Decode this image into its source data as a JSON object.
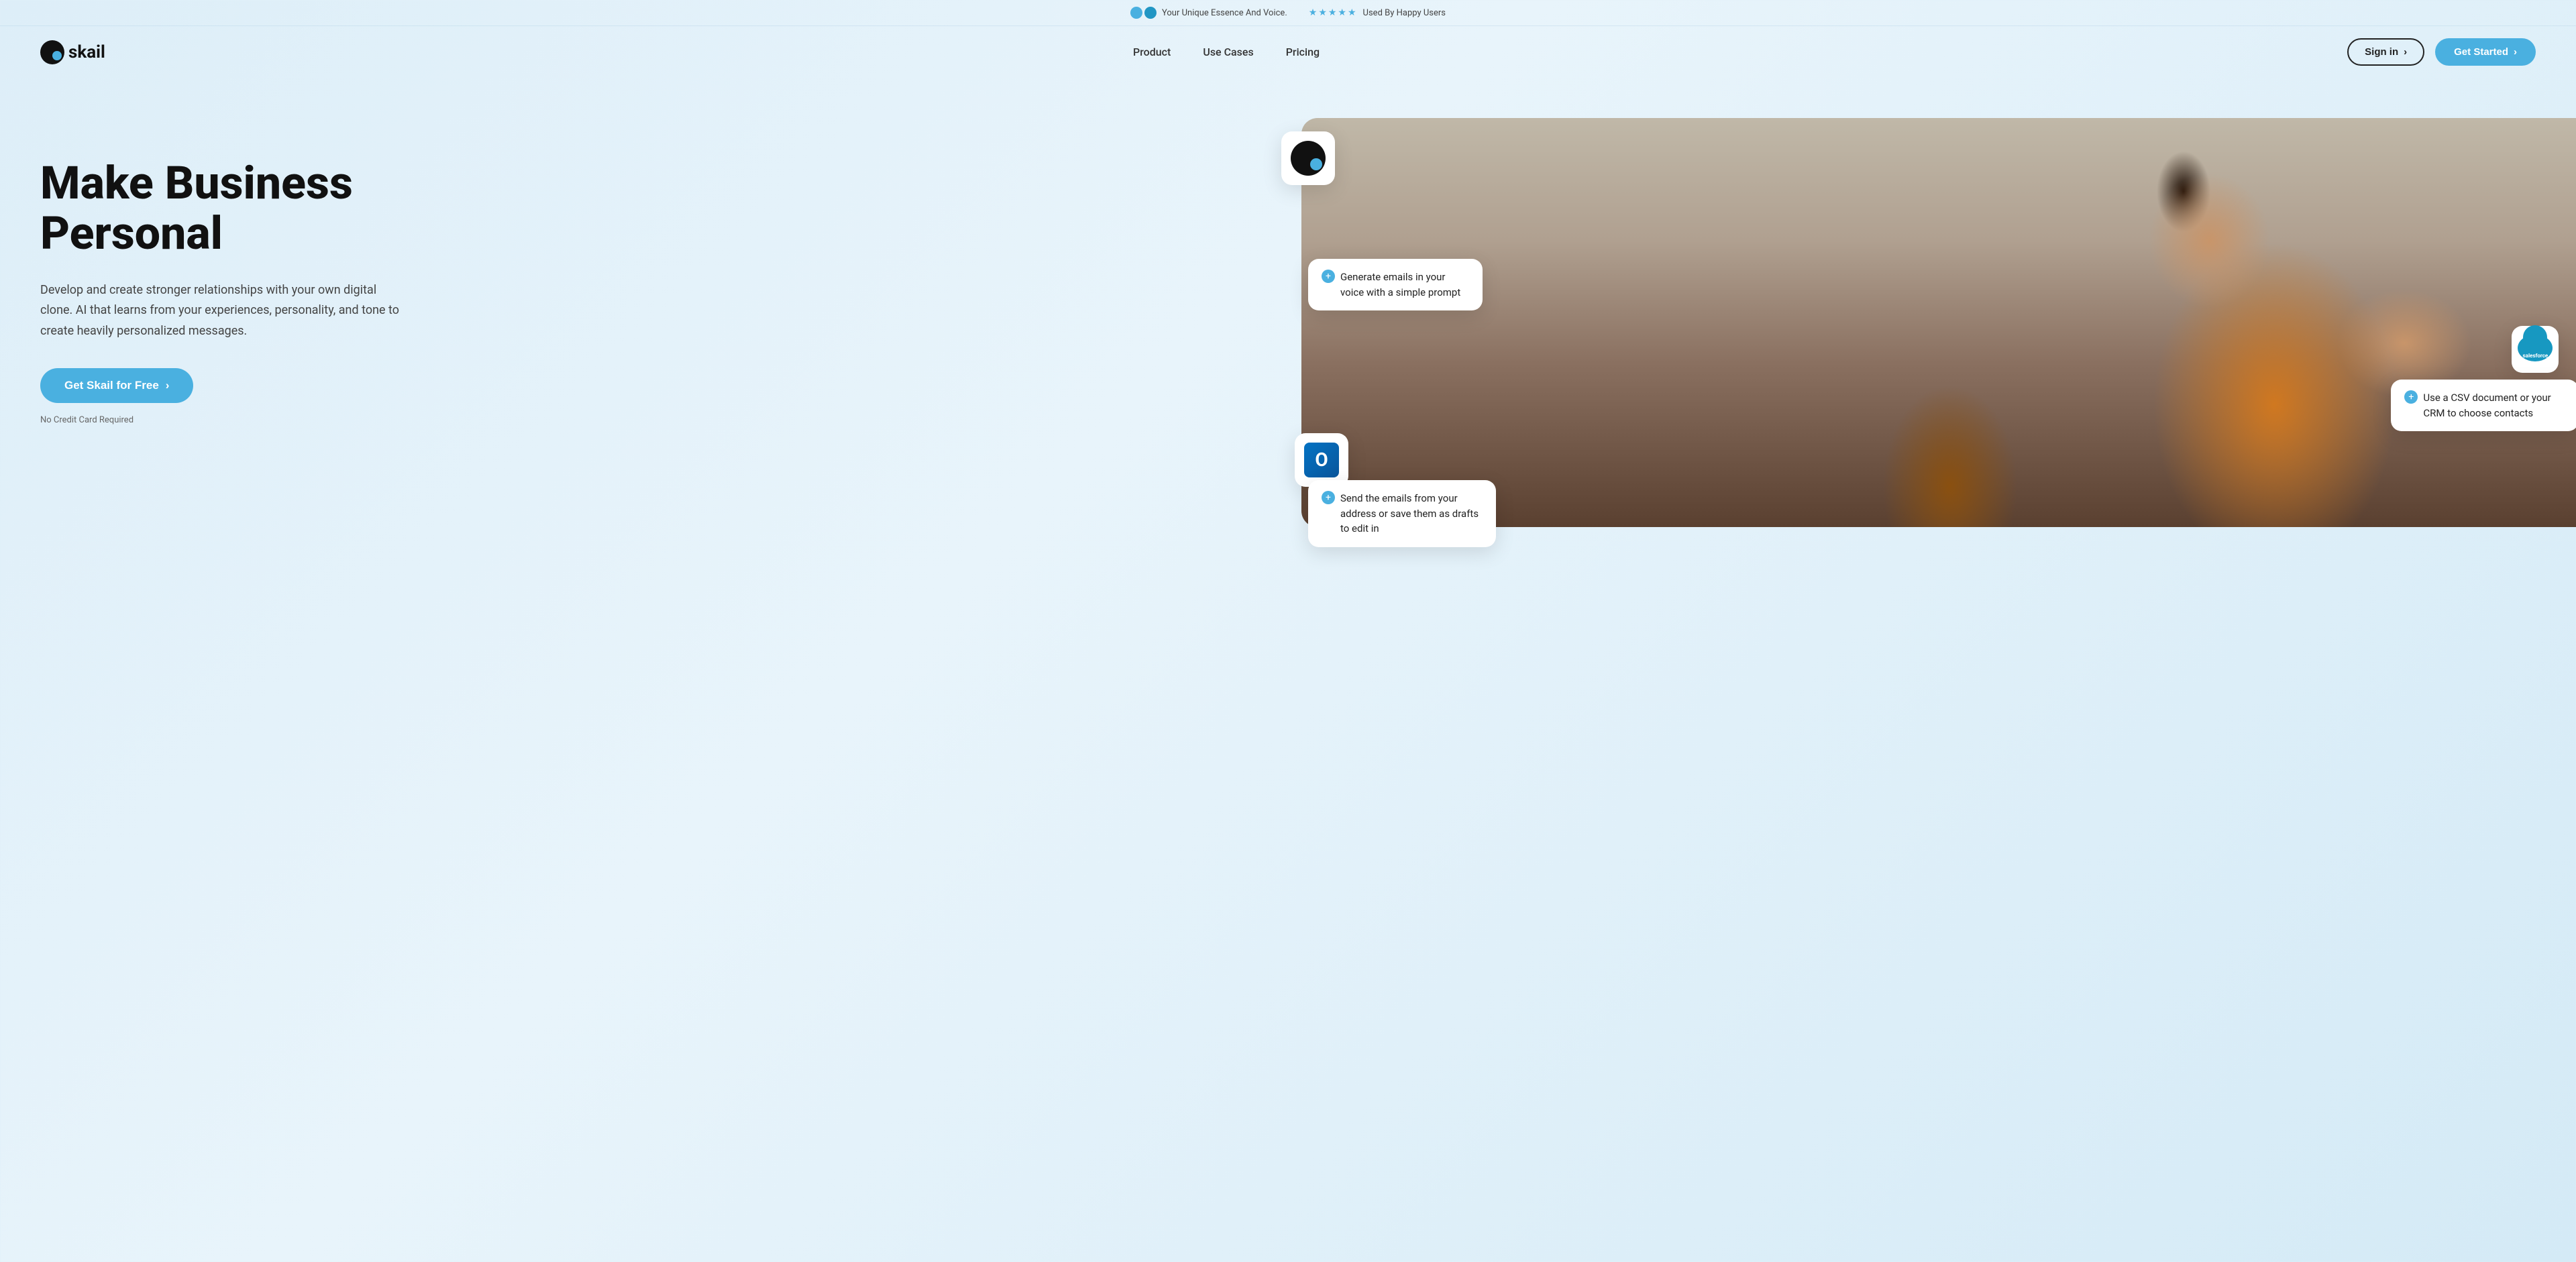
{
  "banner": {
    "item1_icon": "infinity",
    "item1_text": "Your Unique Essence And Voice.",
    "item2_stars": "★★★★★",
    "item2_text": "Used By Happy Users"
  },
  "navbar": {
    "logo_text": "skail",
    "nav_links": [
      {
        "label": "Product",
        "href": "#"
      },
      {
        "label": "Use Cases",
        "href": "#"
      },
      {
        "label": "Pricing",
        "href": "#"
      }
    ],
    "signin_label": "Sign in",
    "signin_arrow": "›",
    "get_started_label": "Get Started",
    "get_started_arrow": "›"
  },
  "hero": {
    "title_line1": "Make Business",
    "title_line2": "Personal",
    "subtitle": "Develop and create stronger relationships with your own digital clone. AI that learns from your experiences, personality, and tone to create heavily personalized messages.",
    "cta_label": "Get Skail for Free",
    "cta_arrow": "›",
    "no_card_text": "No Credit Card Required"
  },
  "floating_cards": {
    "card1_text": "Generate emails in your voice with a simple prompt",
    "card2_text": "Use a CSV document or your CRM to choose contacts",
    "card3_text": "Send the emails from your address or save them as drafts to edit in"
  },
  "colors": {
    "accent": "#4ab0e0",
    "dark": "#111111",
    "bg_start": "#ddeef8",
    "bg_end": "#d4eaf6"
  }
}
